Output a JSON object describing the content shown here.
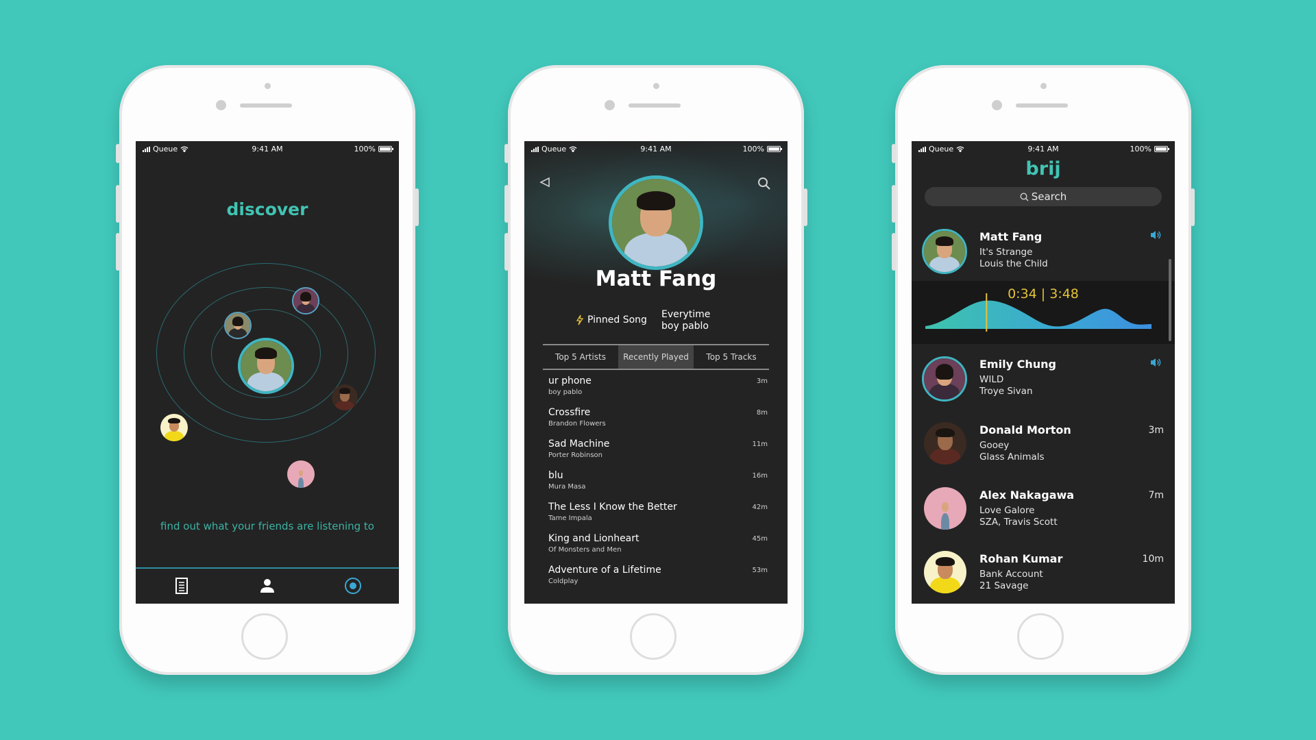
{
  "status_bar": {
    "carrier": "Queue",
    "time": "9:41 AM",
    "battery": "100%"
  },
  "discover": {
    "title": "discover",
    "tagline": "find out what your friends are listening to",
    "tabs": [
      "feed-icon",
      "profile-icon",
      "discover-icon"
    ],
    "accent": "#41c4b3"
  },
  "profile": {
    "name": "Matt Fang",
    "pinned_label": "Pinned Song",
    "pinned_song": {
      "title": "Everytime",
      "artist": "boy pablo"
    },
    "tabs": [
      {
        "label": "Top 5 Artists",
        "active": false
      },
      {
        "label": "Recently Played",
        "active": true
      },
      {
        "label": "Top 5 Tracks",
        "active": false
      }
    ],
    "tracks": [
      {
        "title": "ur phone",
        "artist": "boy pablo",
        "ago": "3m"
      },
      {
        "title": "Crossfire",
        "artist": "Brandon Flowers",
        "ago": "8m"
      },
      {
        "title": "Sad Machine",
        "artist": "Porter Robinson",
        "ago": "11m"
      },
      {
        "title": "blu",
        "artist": "Mura Masa",
        "ago": "16m"
      },
      {
        "title": "The Less I Know the Better",
        "artist": "Tame Impala",
        "ago": "42m"
      },
      {
        "title": "King and Lionheart",
        "artist": "Of Monsters and Men",
        "ago": "45m"
      },
      {
        "title": "Adventure of a Lifetime",
        "artist": "Coldplay",
        "ago": "53m"
      }
    ]
  },
  "feed": {
    "title": "brij",
    "search_placeholder": "Search",
    "player": {
      "position": "0:34",
      "duration": "3:48",
      "timecode": "0:34 | 3:48",
      "progress": 0.149
    },
    "items": [
      {
        "name": "Matt Fang",
        "song": "It's Strange",
        "artist": "Louis the Child",
        "ago": "",
        "playing": true
      },
      {
        "name": "Emily Chung",
        "song": "WILD",
        "artist": "Troye Sivan",
        "ago": "",
        "playing": true
      },
      {
        "name": "Donald Morton",
        "song": "Gooey",
        "artist": "Glass Animals",
        "ago": "3m",
        "playing": false
      },
      {
        "name": "Alex Nakagawa",
        "song": "Love Galore",
        "artist": "SZA, Travis Scott",
        "ago": "7m",
        "playing": false
      },
      {
        "name": "Rohan Kumar",
        "song": "Bank Account",
        "artist": "21 Savage",
        "ago": "10m",
        "playing": false
      }
    ]
  },
  "colors": {
    "background": "#41c8bb",
    "screen": "#232323",
    "accent": "#41c4b3",
    "timecode": "#e5c33a"
  }
}
